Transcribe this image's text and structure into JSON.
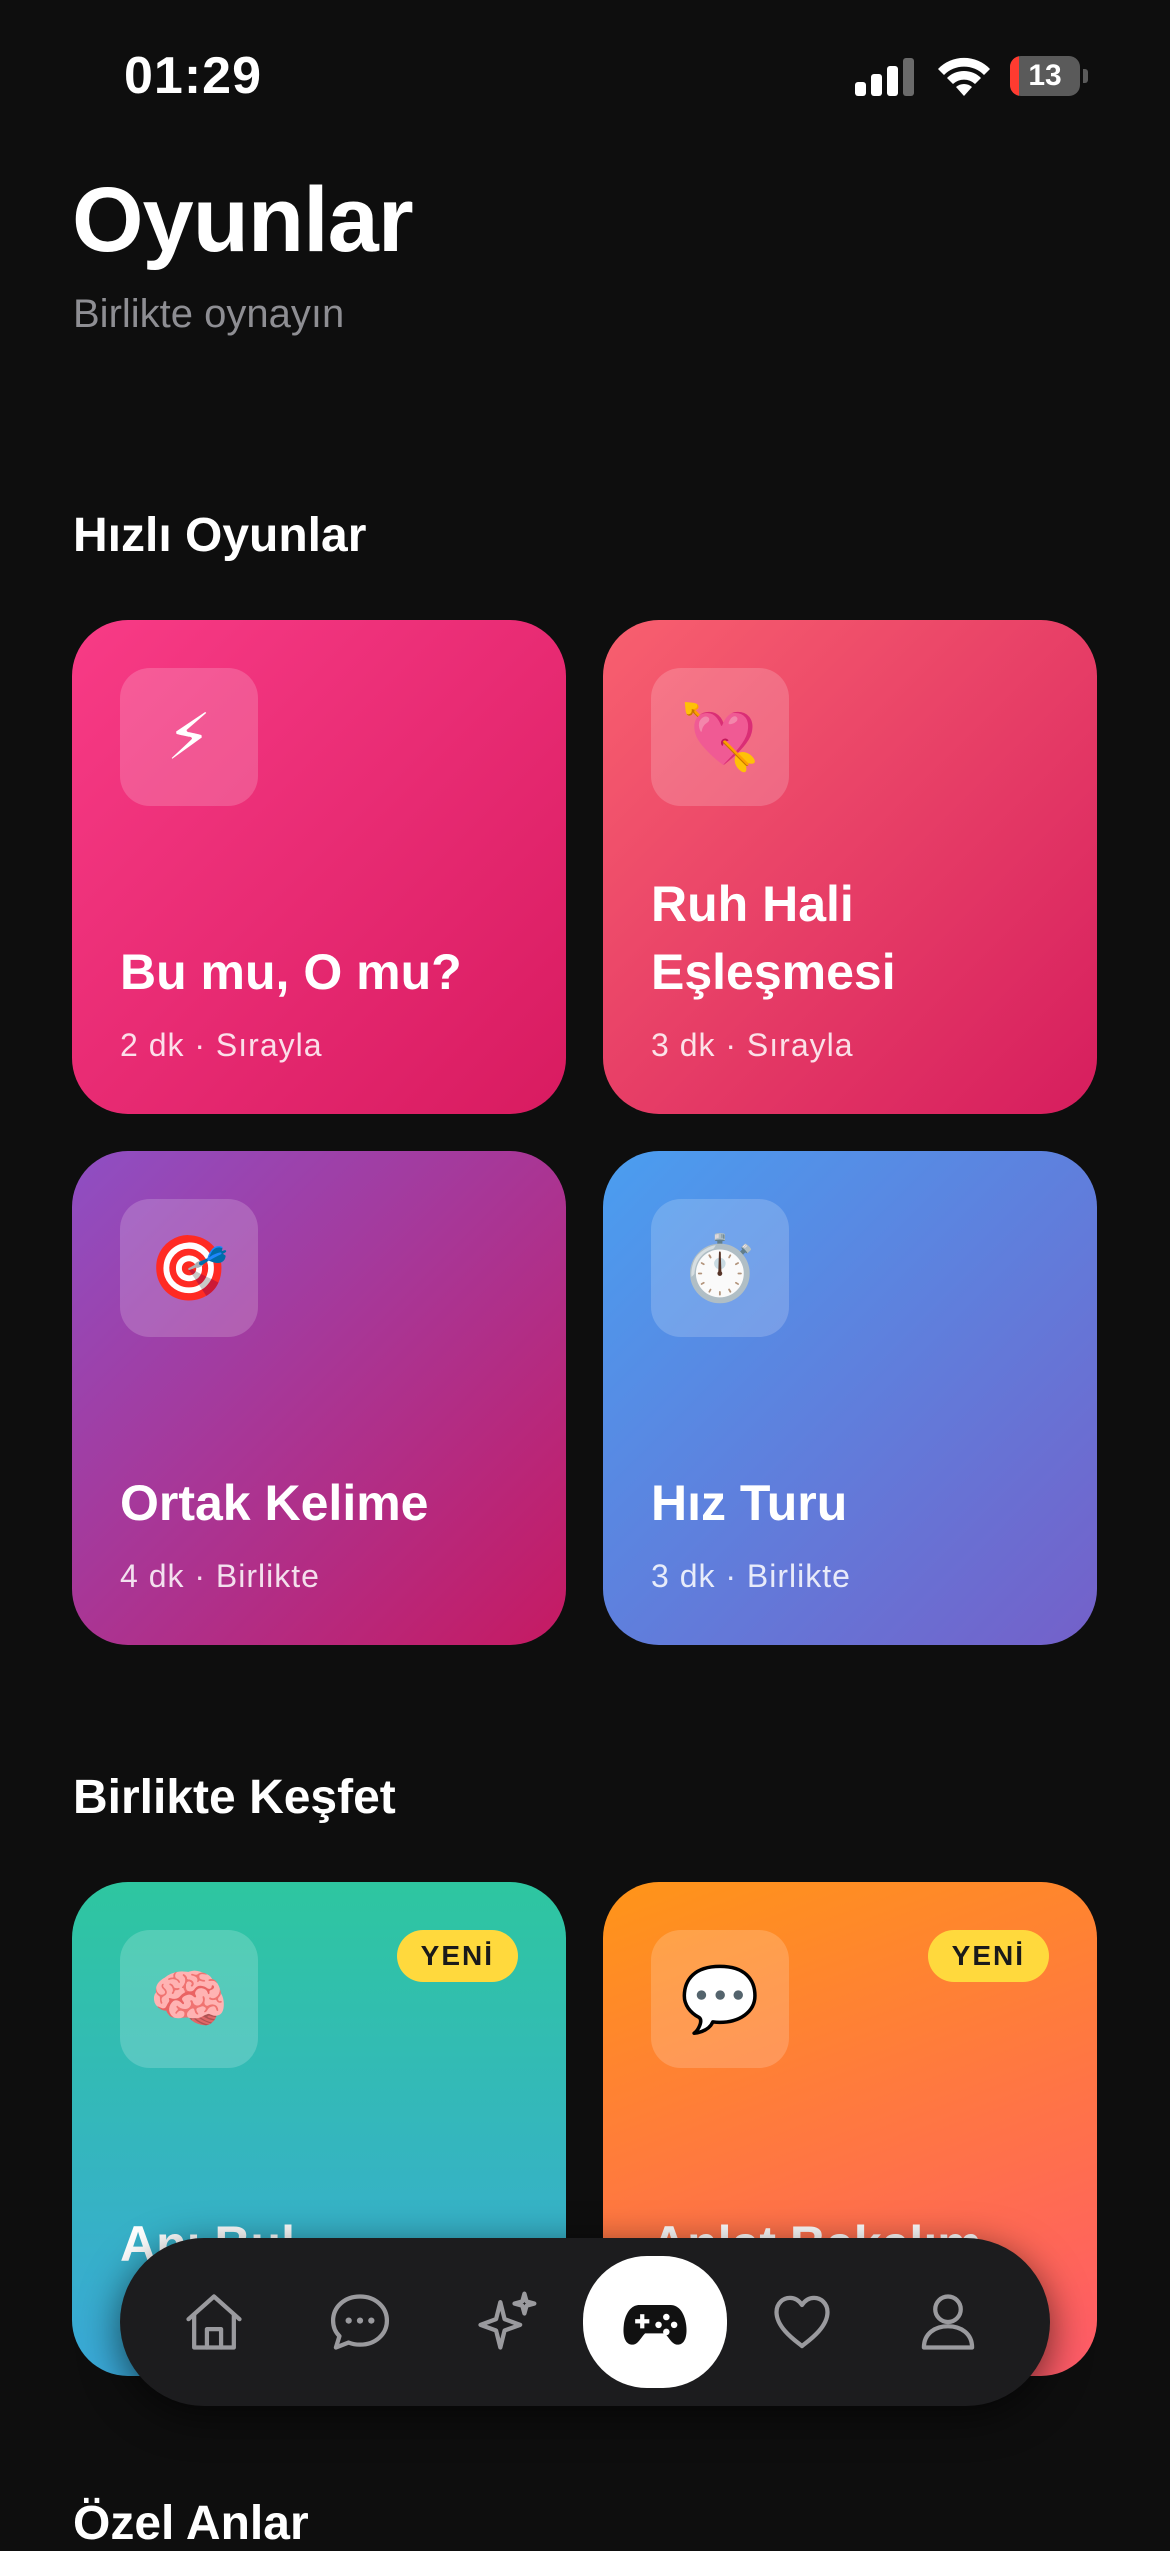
{
  "status_bar": {
    "time": "01:29",
    "battery_level": "13",
    "battery_fraction": 0.13,
    "battery_color": "#ff3b30"
  },
  "header": {
    "title": "Oyunlar",
    "subtitle": "Birlikte oynayın"
  },
  "sections": [
    {
      "title": "Hızlı Oyunlar",
      "cards": [
        {
          "title": "Bu mu, O mu?",
          "meta": "2 dk · Sırayla",
          "icon": "⚡",
          "icon_name": "lightning-icon"
        },
        {
          "title": "Ruh Hali Eşleşmesi",
          "meta": "3 dk · Sırayla",
          "icon": "💘",
          "icon_name": "heart-arrow-icon"
        },
        {
          "title": "Ortak Kelime",
          "meta": "4 dk · Birlikte",
          "icon": "🎯",
          "icon_name": "target-icon"
        },
        {
          "title": "Hız Turu",
          "meta": "3 dk · Birlikte",
          "icon": "⏱️",
          "icon_name": "stopwatch-icon"
        }
      ]
    },
    {
      "title": "Birlikte Keşfet",
      "cards": [
        {
          "title": "Anı Bul",
          "badge": "YENİ",
          "icon": "🧠",
          "icon_name": "brain-icon"
        },
        {
          "title": "Anlat Bakalım",
          "badge": "YENİ",
          "icon": "💬",
          "icon_name": "speech-bubble-icon"
        }
      ]
    },
    {
      "title": "Özel Anlar"
    }
  ],
  "tab_bar": {
    "tabs": [
      {
        "name": "home",
        "icon": "home-icon"
      },
      {
        "name": "chat",
        "icon": "chat-icon"
      },
      {
        "name": "discover",
        "icon": "sparkles-icon"
      },
      {
        "name": "games",
        "icon": "gamepad-icon",
        "active": true
      },
      {
        "name": "favorites",
        "icon": "heart-icon"
      },
      {
        "name": "profile",
        "icon": "person-icon"
      }
    ]
  },
  "colors": {
    "background": "#0e0e0e",
    "badge": "#ffd93d",
    "tab_bar": "#1c1c1e"
  }
}
